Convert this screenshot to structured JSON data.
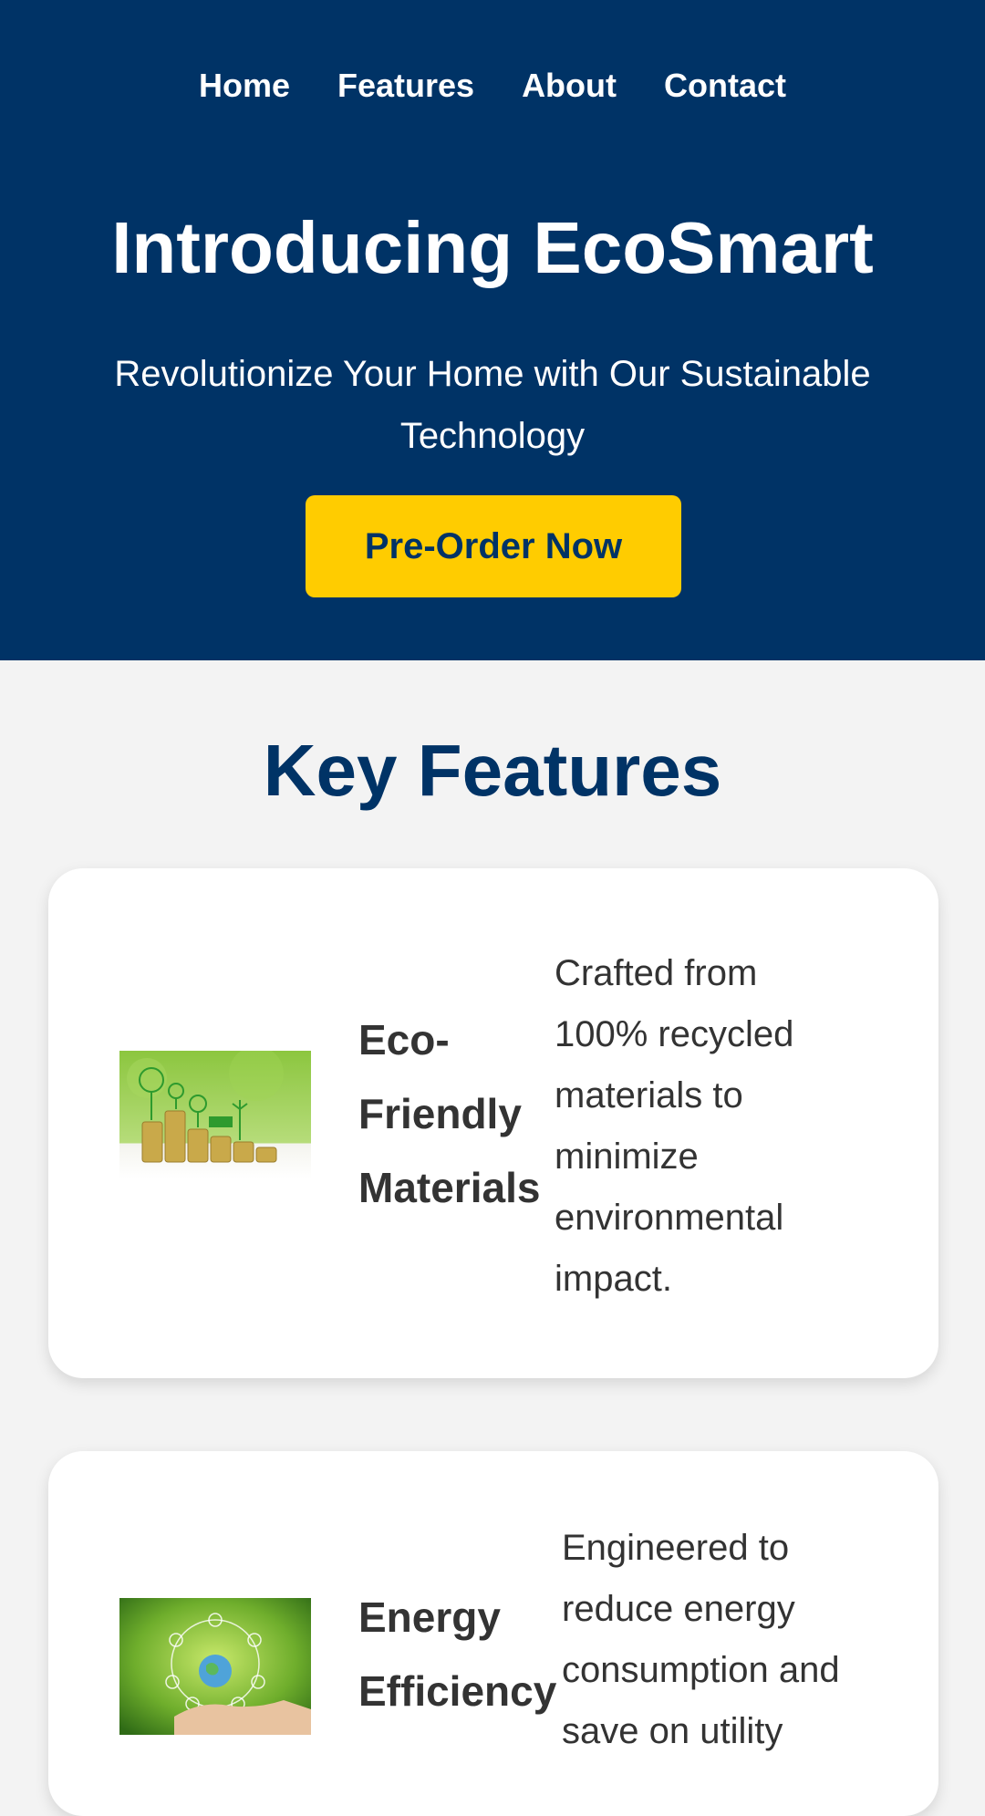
{
  "nav": {
    "items": [
      {
        "label": "Home"
      },
      {
        "label": "Features"
      },
      {
        "label": "About"
      },
      {
        "label": "Contact"
      }
    ]
  },
  "hero": {
    "title": "Introducing EcoSmart",
    "subtitle": "Revolutionize Your Home with Our Sustainable Technology",
    "cta_label": "Pre-Order Now"
  },
  "features": {
    "title": "Key Features",
    "items": [
      {
        "title": "Eco-Friendly Materials",
        "description": "Crafted from 100% recycled materials to minimize environmental impact.",
        "image": "coins-with-green-eco-icons-image"
      },
      {
        "title": "Energy Efficiency",
        "description": "Engineered to reduce energy consumption and save on utility",
        "image": "hand-holding-globe-eco-icons-image"
      }
    ]
  },
  "colors": {
    "primary": "#003366",
    "accent": "#ffcc00",
    "background": "#f3f3f3",
    "card": "#ffffff",
    "text": "#333333"
  }
}
